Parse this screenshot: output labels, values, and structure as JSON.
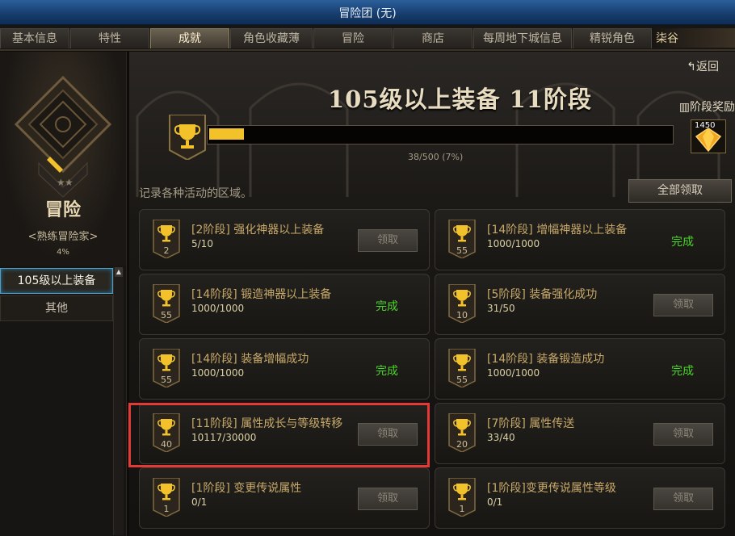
{
  "window": {
    "title": "冒险团 (无)"
  },
  "tabs": [
    {
      "label": "基本信息",
      "active": false
    },
    {
      "label": "特性",
      "active": false
    },
    {
      "label": "成就",
      "active": true
    },
    {
      "label": "角色收藏薄",
      "active": false
    },
    {
      "label": "冒险",
      "active": false
    },
    {
      "label": "商店",
      "active": false
    },
    {
      "label": "每周地下城信息",
      "active": false
    },
    {
      "label": "精锐角色",
      "active": false
    }
  ],
  "tab_extra": "柒谷",
  "sidebar": {
    "name": "冒险",
    "rank": "<熟练冒险家>",
    "percent": "4%",
    "menu": [
      {
        "label": "105级以上装备",
        "selected": true
      },
      {
        "label": "其他",
        "selected": false
      }
    ]
  },
  "main": {
    "back_label": "↰返回",
    "heading": "105级以上装备 11阶段",
    "reward_label": "阶段奖励",
    "progress": {
      "current": 38,
      "total": 500,
      "text": "38/500 (7%)"
    },
    "reward_count": "1450",
    "description": "记录各种活动的区域。",
    "claim_all_label": "全部领取"
  },
  "achievements": [
    {
      "level": "2",
      "title": "[2阶段] 强化神器以上装备",
      "progress": "5/10",
      "status": "claim",
      "button_label": "领取"
    },
    {
      "level": "55",
      "title": "[14阶段] 增幅神器以上装备",
      "progress": "1000/1000",
      "status": "done",
      "done_label": "完成"
    },
    {
      "level": "55",
      "title": "[14阶段] 锻造神器以上装备",
      "progress": "1000/1000",
      "status": "done",
      "done_label": "完成"
    },
    {
      "level": "10",
      "title": "[5阶段] 装备强化成功",
      "progress": "31/50",
      "status": "claim",
      "button_label": "领取"
    },
    {
      "level": "55",
      "title": "[14阶段] 装备增幅成功",
      "progress": "1000/1000",
      "status": "done",
      "done_label": "完成"
    },
    {
      "level": "55",
      "title": "[14阶段] 装备锻造成功",
      "progress": "1000/1000",
      "status": "done",
      "done_label": "完成"
    },
    {
      "level": "40",
      "title": "[11阶段] 属性成长与等级转移",
      "progress": "10117/30000",
      "status": "claim",
      "button_label": "领取"
    },
    {
      "level": "20",
      "title": "[7阶段] 属性传送",
      "progress": "33/40",
      "status": "claim",
      "button_label": "领取"
    },
    {
      "level": "1",
      "title": "[1阶段] 变更传说属性",
      "progress": "0/1",
      "status": "claim",
      "button_label": "领取"
    },
    {
      "level": "1",
      "title": "[1阶段]变更传说属性等级",
      "progress": "0/1",
      "status": "claim",
      "button_label": "领取"
    }
  ],
  "colors": {
    "accent_gold": "#f3c22a",
    "done_green": "#4bd42a",
    "highlight_red": "#e43a37",
    "title_bar_blue": "#1a4a82"
  },
  "icons": {
    "cup": "trophy-icon",
    "gift": "gift-icon",
    "gem": "reward-gem-icon",
    "back": "return-arrow-icon"
  }
}
